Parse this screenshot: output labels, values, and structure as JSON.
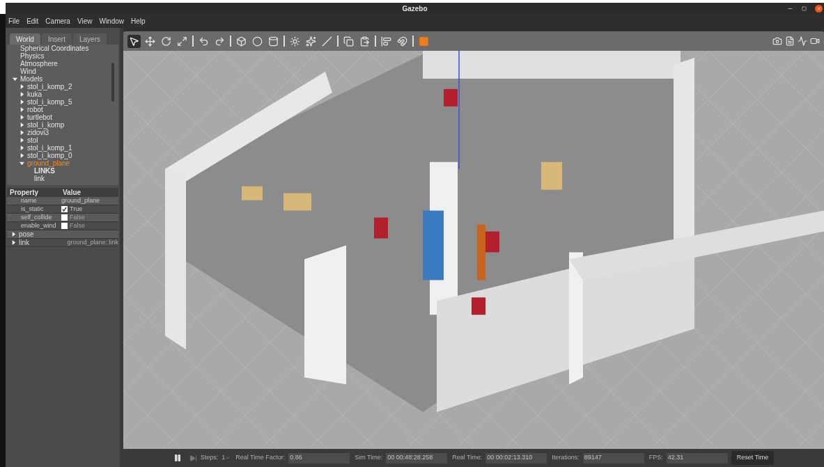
{
  "window": {
    "title": "Gazebo"
  },
  "menu": [
    "File",
    "Edit",
    "Camera",
    "View",
    "Window",
    "Help"
  ],
  "tabs": [
    {
      "label": "World",
      "selected": true
    },
    {
      "label": "Insert",
      "selected": false
    },
    {
      "label": "Layers",
      "selected": false
    }
  ],
  "tree": [
    {
      "label": "Spherical Coordinates",
      "selected": false
    },
    {
      "label": "Physics",
      "selected": false
    },
    {
      "label": "Atmosphere",
      "selected": false
    },
    {
      "label": "Wind",
      "selected": false
    },
    {
      "label": "Models",
      "selected": false,
      "expanded": true,
      "children": [
        {
          "label": "stol_i_komp_2",
          "selected": false,
          "expanded": false
        },
        {
          "label": "kuka",
          "selected": false,
          "expanded": false
        },
        {
          "label": "stol_i_komp_5",
          "selected": false,
          "expanded": false
        },
        {
          "label": "robot",
          "selected": false,
          "expanded": false
        },
        {
          "label": "turtlebot",
          "selected": false,
          "expanded": false
        },
        {
          "label": "stol_i_komp",
          "selected": false,
          "expanded": false
        },
        {
          "label": "zidovi3",
          "selected": false,
          "expanded": false
        },
        {
          "label": "stol",
          "selected": false,
          "expanded": false
        },
        {
          "label": "stol_i_komp_1",
          "selected": false,
          "expanded": false
        },
        {
          "label": "stol_i_komp_0",
          "selected": false,
          "expanded": false
        },
        {
          "label": "ground_plane",
          "selected": true,
          "expanded": true,
          "children": [
            {
              "label": "LINKS",
              "selected": false,
              "kind": "heading"
            },
            {
              "label": "link",
              "selected": false
            }
          ]
        }
      ]
    }
  ],
  "properties": {
    "columns": [
      "Property",
      "Value"
    ],
    "rows": [
      {
        "kind": "text",
        "name": "name",
        "value": "ground_plane"
      },
      {
        "kind": "checkbox",
        "name": "is_static",
        "value": "True",
        "checked": true
      },
      {
        "kind": "checkbox",
        "name": "self_collide",
        "value": "False",
        "checked": false
      },
      {
        "kind": "checkbox",
        "name": "enable_wind",
        "value": "False",
        "checked": false
      },
      {
        "kind": "group",
        "name": "pose",
        "expanded": false
      },
      {
        "kind": "group",
        "name": "link",
        "value": "ground_plane::link",
        "expanded": false
      }
    ]
  },
  "toolbar": [
    {
      "kind": "select",
      "selected": true
    },
    {
      "kind": "translate",
      "selected": false
    },
    {
      "kind": "rotate",
      "selected": false
    },
    {
      "kind": "scale",
      "selected": false
    },
    {
      "kind": "sep"
    },
    {
      "kind": "undo",
      "selected": false
    },
    {
      "kind": "redo",
      "selected": false
    },
    {
      "kind": "sep"
    },
    {
      "kind": "box",
      "selected": false
    },
    {
      "kind": "sphere",
      "selected": false
    },
    {
      "kind": "cylinder",
      "selected": false
    },
    {
      "kind": "sep"
    },
    {
      "kind": "pointlight",
      "selected": false
    },
    {
      "kind": "spotlight",
      "selected": false
    },
    {
      "kind": "dirlight",
      "selected": false
    },
    {
      "kind": "sep"
    },
    {
      "kind": "copy",
      "selected": false
    },
    {
      "kind": "paste",
      "selected": false
    },
    {
      "kind": "sep"
    },
    {
      "kind": "align",
      "selected": false
    },
    {
      "kind": "snap",
      "selected": false
    },
    {
      "kind": "sep"
    },
    {
      "kind": "view",
      "selected": false
    }
  ],
  "status_bar": {
    "steps_label": "Steps:",
    "steps": "1",
    "fields": [
      {
        "label": "Real Time Factor:",
        "value": "0.86"
      },
      {
        "label": "Sim Time:",
        "value": "00 00:48:28.258"
      },
      {
        "label": "Real Time:",
        "value": "00 00:02:13.310"
      },
      {
        "label": "Iterations:",
        "value": "89147"
      },
      {
        "label": "FPS:",
        "value": "42.31"
      }
    ],
    "button": "Reset Time"
  }
}
